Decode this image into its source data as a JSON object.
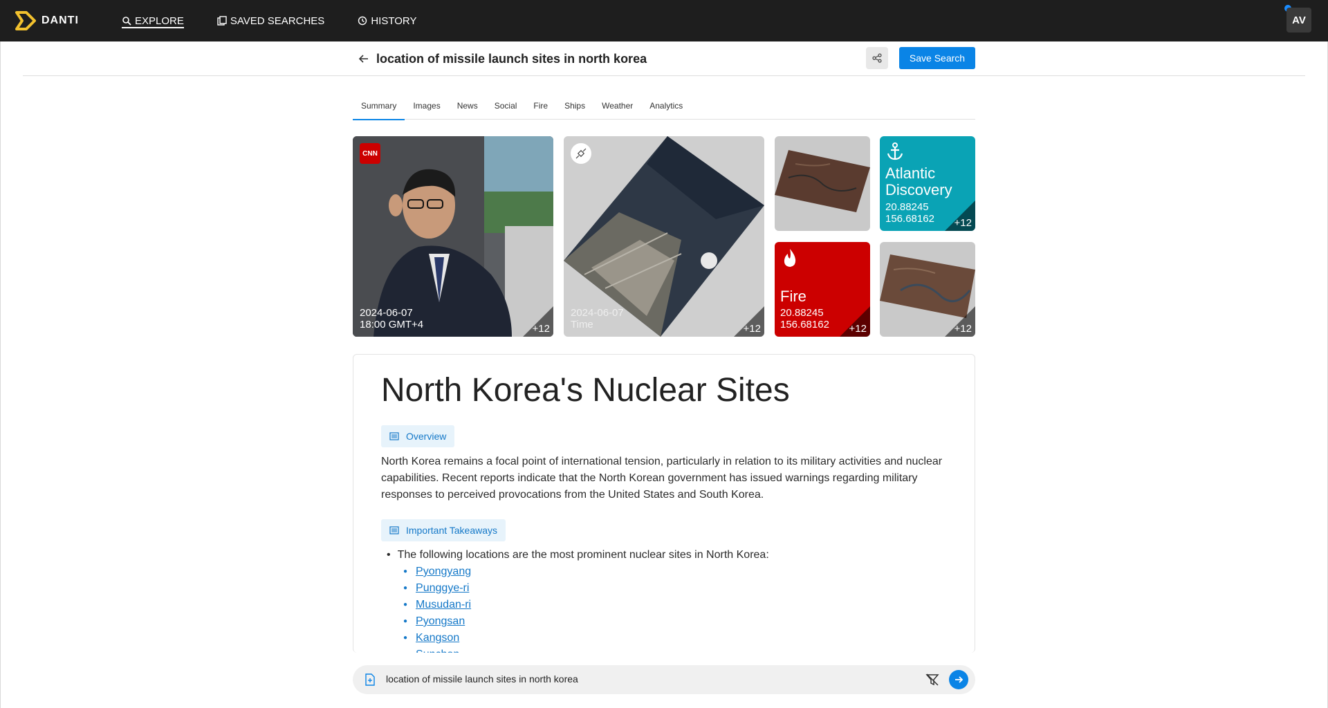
{
  "brand": {
    "name": "DANTI"
  },
  "nav": {
    "items": [
      {
        "label": "EXPLORE",
        "icon": "search-icon",
        "active": true
      },
      {
        "label": "SAVED SEARCHES",
        "icon": "bookmark-icon",
        "active": false
      },
      {
        "label": "HISTORY",
        "icon": "history-icon",
        "active": false
      }
    ],
    "user_initials": "AV"
  },
  "search": {
    "query": "location of missile launch sites in north korea",
    "save_label": "Save Search"
  },
  "tabs": [
    {
      "label": "Summary",
      "active": true
    },
    {
      "label": "Images"
    },
    {
      "label": "News"
    },
    {
      "label": "Social"
    },
    {
      "label": "Fire"
    },
    {
      "label": "Ships"
    },
    {
      "label": "Weather"
    },
    {
      "label": "Analytics"
    }
  ],
  "cards": {
    "news": {
      "source_badge": "CNN",
      "date": "2024-06-07",
      "time": "18:00 GMT+4",
      "more": "+12"
    },
    "satellite": {
      "date": "2024-06-07",
      "time": "Time",
      "more": "+12"
    },
    "ship": {
      "title_line1": "Atlantic",
      "title_line2": "Discovery",
      "lat": "20.88245",
      "lon": "156.68162",
      "more": "+12"
    },
    "fire": {
      "title": "Fire",
      "lat": "20.88245",
      "lon": "156.68162",
      "more": "+12"
    },
    "image2": {
      "more": "+12"
    }
  },
  "summary": {
    "title": "North Korea's Nuclear Sites",
    "overview_label": "Overview",
    "overview_text": "North Korea remains a focal point of international tension, particularly in relation to its military activities and nuclear capabilities. Recent reports indicate that the North Korean government has issued warnings regarding military responses to perceived provocations from the United States and South Korea.",
    "takeaways_label": "Important Takeaways",
    "takeaway_intro": "The following locations are the most prominent nuclear sites in North Korea:",
    "locations": [
      "Pyongyang",
      "Punggye-ri",
      "Musudan-ri",
      "Pyongsan",
      "Kangson",
      "Sunchon"
    ]
  },
  "bottom_search": {
    "value": "location of missile launch sites in north korea"
  },
  "colors": {
    "accent": "#0a84e6",
    "ship_card": "#0aa3b5",
    "fire_card": "#cc0000",
    "topbar": "#1e1e1e"
  }
}
